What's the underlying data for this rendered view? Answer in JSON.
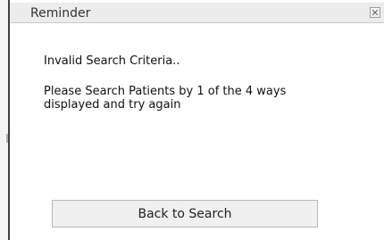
{
  "dialog": {
    "title": "Reminder",
    "close_icon": "close-icon",
    "message_line1": "Invalid Search Criteria..",
    "message_line2": "Please Search Patients by 1 of the 4 ways displayed and try again",
    "back_button_label": "Back to Search"
  },
  "colors": {
    "title_bar": "#ececec",
    "button_bg": "#f0f0f0",
    "border_dark": "#404040"
  }
}
